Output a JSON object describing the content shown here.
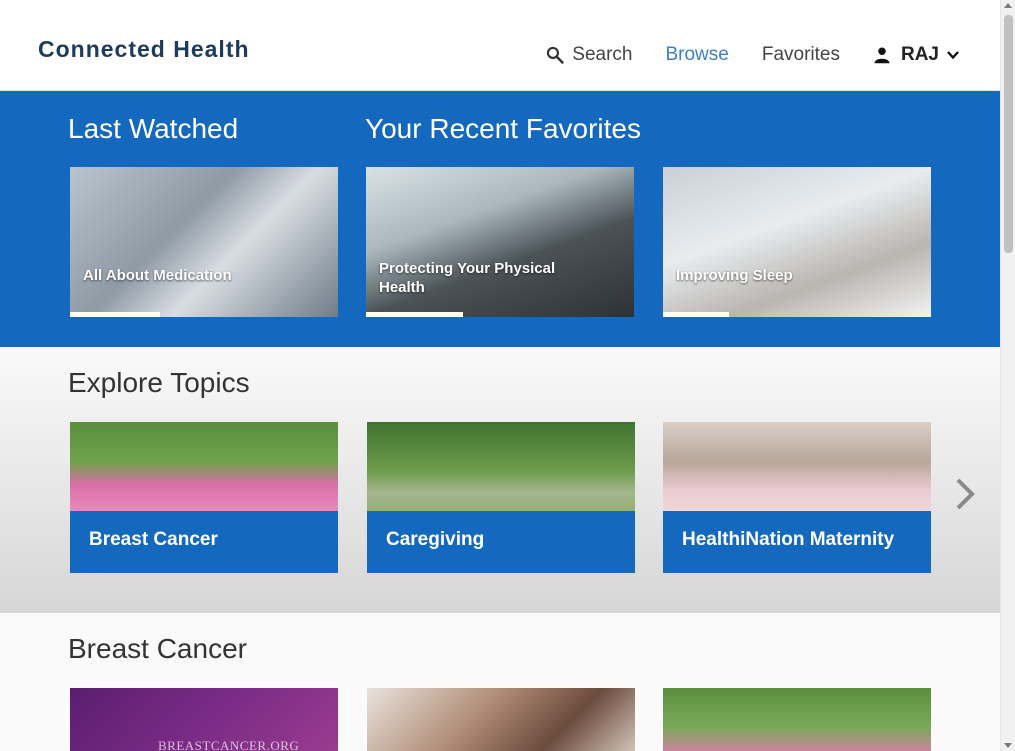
{
  "app": {
    "title": "Connected Health"
  },
  "nav": {
    "search_label": "Search",
    "browse_label": "Browse",
    "favorites_label": "Favorites",
    "user_name": "RAJ",
    "active_item": "Browse",
    "icons": [
      "search-icon",
      "user-icon",
      "chevron-down-icon"
    ]
  },
  "last_watched": {
    "heading": "Last Watched",
    "items": [
      {
        "title": "All About Medication",
        "progress": 0.34
      }
    ]
  },
  "recent_favorites": {
    "heading": "Your Recent Favorites",
    "items": [
      {
        "title": "Protecting Your Physical Health",
        "progress": 0.36
      },
      {
        "title": "Improving Sleep",
        "progress": 0.25
      }
    ]
  },
  "explore": {
    "heading": "Explore Topics",
    "topics": [
      {
        "label": "Breast Cancer"
      },
      {
        "label": "Caregiving"
      },
      {
        "label": "HealthiNation Maternity"
      }
    ],
    "next_icon": "chevron-right-icon"
  },
  "breast_cancer": {
    "heading": "Breast Cancer",
    "items": [
      {
        "overlay_text": "BREASTCANCER.ORG"
      },
      {
        "overlay_text": ""
      },
      {
        "overlay_text": ""
      }
    ]
  },
  "colors": {
    "brand_blue": "#1469bf",
    "logo_navy": "#1d3c5c",
    "active_nav": "#3b82c4"
  }
}
